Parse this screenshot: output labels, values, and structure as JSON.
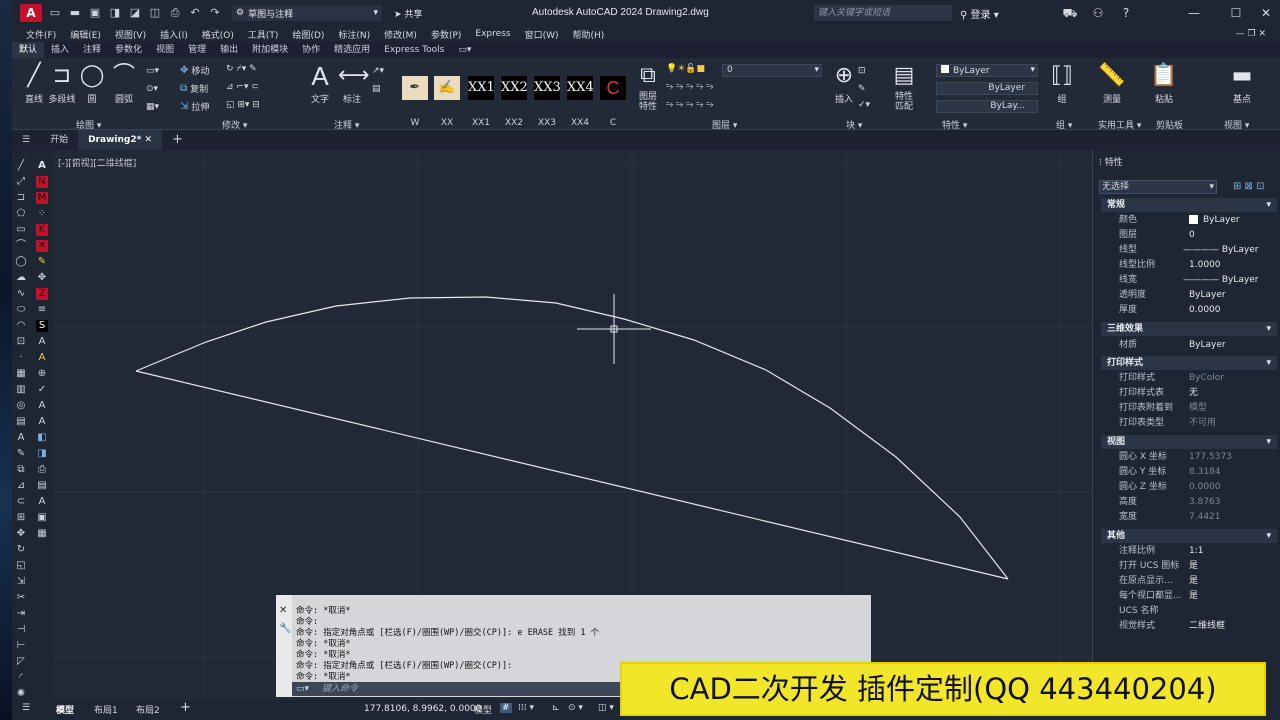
{
  "titlebar": {
    "logo": "A",
    "workspace": "草图与注释",
    "share": "共享",
    "app_title": "Autodesk AutoCAD 2024    Drawing2.dwg",
    "search_placeholder": "键入关键字或短语",
    "login": "登录"
  },
  "menubar": [
    "文件(F)",
    "编辑(E)",
    "视图(V)",
    "插入(I)",
    "格式(O)",
    "工具(T)",
    "绘图(D)",
    "标注(N)",
    "修改(M)",
    "参数(P)",
    "Express",
    "窗口(W)",
    "帮助(H)"
  ],
  "ribbon_tabs": [
    "默认",
    "插入",
    "注释",
    "参数化",
    "视图",
    "管理",
    "输出",
    "附加模块",
    "协作",
    "精选应用",
    "Express Tools"
  ],
  "ribbon": {
    "draw": {
      "line": "直线",
      "polyline": "多段线",
      "circle": "圆",
      "arc": "圆弧",
      "panel": "绘图"
    },
    "modify": {
      "move": "移动",
      "copy": "复制",
      "stretch": "拉伸",
      "panel": "修改"
    },
    "annotation": {
      "text": "文字",
      "dimension": "标注",
      "panel": "注释"
    },
    "styles": [
      "W",
      "XX",
      "XX1",
      "XX2",
      "XX3",
      "XX4",
      "C"
    ],
    "layers": {
      "layer_props": "图层\n特性",
      "current_layer": "0",
      "panel": "图层"
    },
    "block": {
      "insert": "插入",
      "panel": "块"
    },
    "properties": {
      "match": "特性\n匹配",
      "color": "ByLayer",
      "linetype": "ByLayer",
      "lineweight": "ByLay...",
      "panel": "特性"
    },
    "groups": {
      "group": "组",
      "panel": "组"
    },
    "utilities": {
      "measure": "测量",
      "panel": "实用工具"
    },
    "clipboard": {
      "paste": "粘贴",
      "panel": "剪贴板"
    },
    "view": {
      "base": "基点",
      "panel": "视图"
    }
  },
  "doc_tabs": {
    "start": "开始",
    "drawing": "Drawing2*"
  },
  "canvas": {
    "view_label": "[-][俯视][二维线框]"
  },
  "properties": {
    "title": "特性",
    "selection": "无选择",
    "sections": {
      "general": {
        "title": "常规",
        "rows": [
          {
            "name": "颜色",
            "value": "ByLayer"
          },
          {
            "name": "图层",
            "value": "0"
          },
          {
            "name": "线型",
            "value": "ByLayer"
          },
          {
            "name": "线型比例",
            "value": "1.0000"
          },
          {
            "name": "线宽",
            "value": "ByLayer"
          },
          {
            "name": "透明度",
            "value": "ByLayer"
          },
          {
            "name": "厚度",
            "value": "0.0000"
          }
        ]
      },
      "3d": {
        "title": "三维效果",
        "rows": [
          {
            "name": "材质",
            "value": "ByLayer"
          }
        ]
      },
      "plot": {
        "title": "打印样式",
        "rows": [
          {
            "name": "打印样式",
            "value": "ByColor"
          },
          {
            "name": "打印样式表",
            "value": "无"
          },
          {
            "name": "打印表附着到",
            "value": "模型"
          },
          {
            "name": "打印表类型",
            "value": "不可用"
          }
        ]
      },
      "view": {
        "title": "视图",
        "rows": [
          {
            "name": "圆心 X 坐标",
            "value": "177.5373"
          },
          {
            "name": "圆心 Y 坐标",
            "value": "8.3184"
          },
          {
            "name": "圆心 Z 坐标",
            "value": "0.0000"
          },
          {
            "name": "高度",
            "value": "3.8763"
          },
          {
            "name": "宽度",
            "value": "7.4421"
          }
        ]
      },
      "misc": {
        "title": "其他",
        "rows": [
          {
            "name": "注释比例",
            "value": "1:1"
          },
          {
            "name": "打开 UCS 图标",
            "value": "是"
          },
          {
            "name": "在原点显示...",
            "value": "是"
          },
          {
            "name": "每个视口都显...",
            "value": "是"
          },
          {
            "name": "UCS 名称",
            "value": ""
          },
          {
            "name": "视觉样式",
            "value": "二维线框"
          }
        ]
      }
    }
  },
  "command": {
    "lines": [
      "命令: *取消*",
      "命令:",
      "命令: 指定对角点或 [栏选(F)/圈围(WP)/圈交(CP)]: e ERASE 找到 1 个",
      "命令: *取消*",
      "命令: *取消*",
      "命令: 指定对角点或 [栏选(F)/圈围(WP)/圈交(CP)]:",
      "命令: *取消*"
    ],
    "placeholder": "键入命令"
  },
  "statusbar": {
    "model": "模型",
    "layout1": "布局1",
    "layout2": "布局2",
    "coords": "177.8106, 8.9962, 0.0000",
    "model_btn": "模型"
  },
  "banner": "CAD二次开发 插件定制(QQ 443440204)",
  "colors": {
    "canvas": "#212836",
    "ui": "#1f2633",
    "banner": "#f2e62a",
    "accent": "#c8102e"
  }
}
